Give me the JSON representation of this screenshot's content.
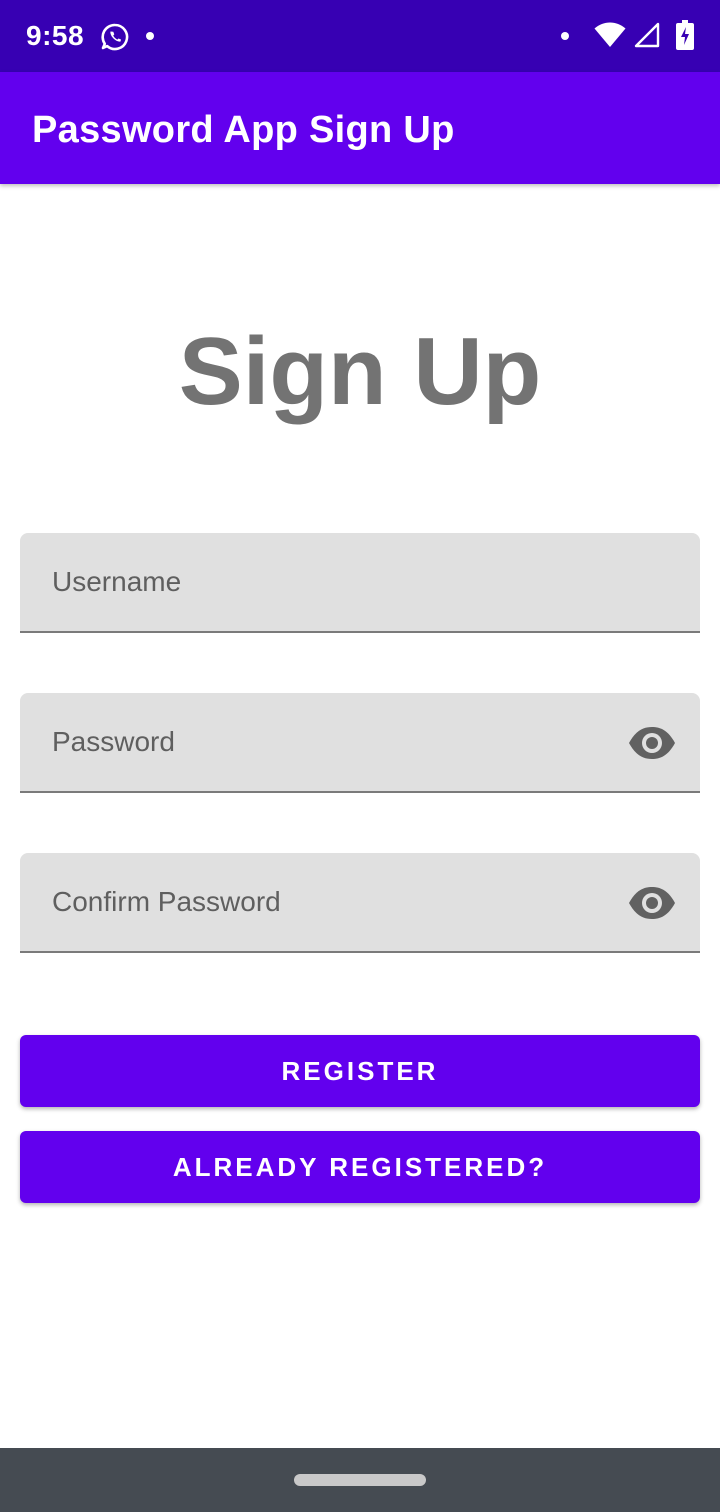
{
  "status_bar": {
    "time": "9:58",
    "icons": [
      "whatsapp-icon",
      "notification-dot-icon",
      "wifi-icon",
      "cellular-signal-icon",
      "battery-charging-icon"
    ]
  },
  "app_bar": {
    "title": "Password App Sign Up"
  },
  "main": {
    "heading": "Sign Up",
    "username": {
      "placeholder": "Username",
      "value": ""
    },
    "password": {
      "placeholder": "Password",
      "value": "",
      "toggle_icon": "eye-icon"
    },
    "confirm_password": {
      "placeholder": "Confirm Password",
      "value": "",
      "toggle_icon": "eye-icon"
    },
    "register_label": "REGISTER",
    "already_registered_label": "ALREADY REGISTERED?"
  },
  "colors": {
    "status_bar": "#3700b3",
    "primary": "#6200ee",
    "heading_text": "#737373",
    "field_background": "#e0e0e0",
    "nav_bar": "#454b52"
  }
}
